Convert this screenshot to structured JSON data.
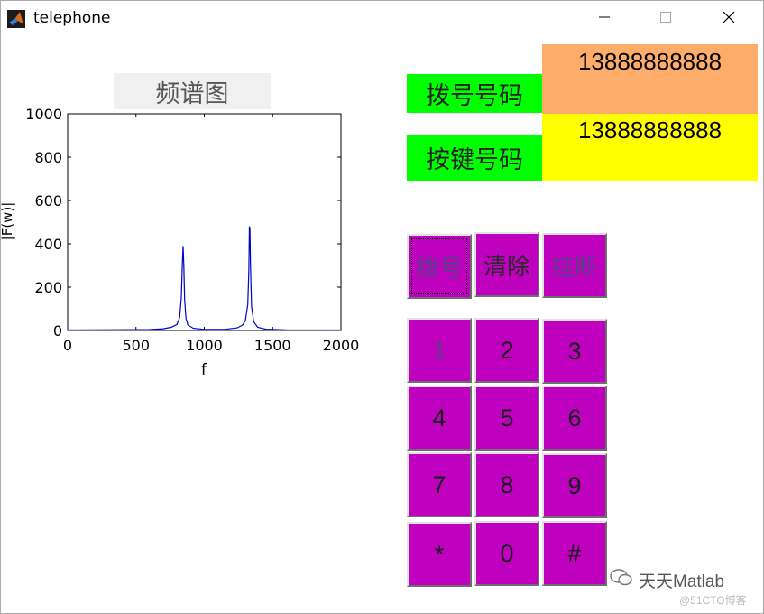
{
  "window": {
    "title": "telephone",
    "icon": "matlab-icon"
  },
  "plot": {
    "title": "频谱图",
    "xlabel": "f",
    "ylabel": "|F(w)|"
  },
  "chart_data": {
    "type": "line",
    "title": "频谱图",
    "xlabel": "f",
    "ylabel": "|F(w)|",
    "xlim": [
      0,
      2000
    ],
    "ylim": [
      0,
      1000
    ],
    "xticks": [
      0,
      500,
      1000,
      1500,
      2000
    ],
    "yticks": [
      0,
      200,
      400,
      600,
      800,
      1000
    ],
    "grid": false,
    "series": [
      {
        "color": "#0000cc",
        "x": [
          0,
          600,
          700,
          760,
          800,
          820,
          832,
          840,
          845,
          850,
          856,
          866,
          880,
          920,
          1000,
          1150,
          1240,
          1280,
          1300,
          1318,
          1326,
          1330,
          1334,
          1338,
          1346,
          1362,
          1390,
          1450,
          1600,
          2000
        ],
        "y": [
          2,
          4,
          8,
          15,
          28,
          60,
          150,
          320,
          390,
          300,
          140,
          55,
          25,
          10,
          5,
          5,
          12,
          25,
          45,
          120,
          280,
          480,
          470,
          300,
          110,
          40,
          15,
          6,
          3,
          2
        ]
      }
    ]
  },
  "labels": {
    "dial_number": "拨号号码",
    "key_number": "按键号码"
  },
  "displays": {
    "dial_number_value": "13888888888",
    "key_number_value": "13888888888"
  },
  "controls": {
    "dial": "拨号",
    "clear": "清除",
    "hangup": "挂断"
  },
  "keypad": [
    "1",
    "2",
    "3",
    "4",
    "5",
    "6",
    "7",
    "8",
    "9",
    "*",
    "0",
    "#"
  ],
  "colors": {
    "green_label": "#00ff00",
    "dial_display": "#fdac6a",
    "key_display": "#ffff00",
    "button": "#bf00bf"
  },
  "watermark": {
    "main": "天天Matlab",
    "sub": "@51CTO博客"
  }
}
